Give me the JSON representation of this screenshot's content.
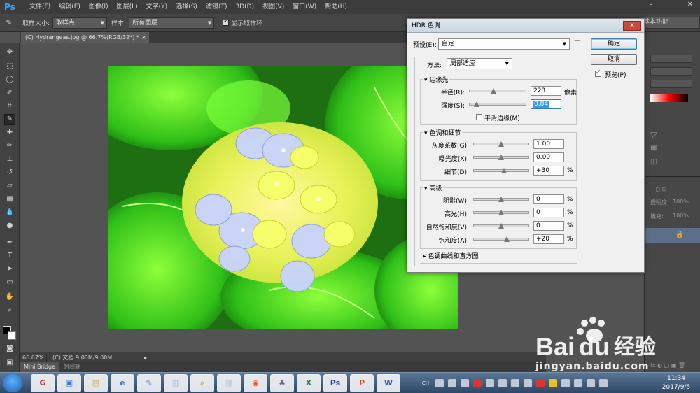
{
  "app": {
    "logo": "Ps",
    "menu": [
      "文件(F)",
      "编辑(E)",
      "图像(I)",
      "图层(L)",
      "文字(Y)",
      "选择(S)",
      "滤镜(T)",
      "3D(D)",
      "视图(V)",
      "窗口(W)",
      "帮助(H)"
    ]
  },
  "options": {
    "sample_size_label": "取样大小:",
    "sample_size_value": "取样点",
    "sample_label": "样本:",
    "sample_value": "所有图层",
    "show_ring_label": "显示取样环",
    "workspace": "基本功能"
  },
  "document": {
    "tab_title": "(C) Hydrangeas.jpg @ 66.7%(RGB/32*) *",
    "tab_close": "×",
    "zoom": "66.67%",
    "doc_info": "(C) 文档:9.00M/9.00M"
  },
  "bottom_tabs": [
    "Mini Bridge",
    "时间轴"
  ],
  "right_panel": {
    "opacity_label": "透明度:",
    "opacity_value": "100%",
    "fill_label": "填充:",
    "fill_value": "100%"
  },
  "dialog": {
    "title": "HDR 色调",
    "preset_label": "预设(E):",
    "preset_value": "自定",
    "ok": "确定",
    "cancel": "取消",
    "preview_label": "预览(P)",
    "method_label": "方法:",
    "method_value": "局部适应",
    "edge_glow": {
      "title": "边缘光",
      "radius_label": "半径(R):",
      "radius_value": "223",
      "radius_unit": "像素",
      "radius_level": 0.43,
      "strength_label": "强度(S):",
      "strength_value": "0.84",
      "strength_level": 0.12,
      "smooth_label": "平滑边缘(M)"
    },
    "tone_detail": {
      "title": "色调和细节",
      "gamma_label": "灰度系数(G):",
      "gamma_value": "1.00",
      "gamma_level": 0.5,
      "exposure_label": "曝光度(X):",
      "exposure_value": "0.00",
      "exposure_level": 0.5,
      "detail_label": "细节(D):",
      "detail_value": "+30",
      "detail_unit": "%",
      "detail_level": 0.55
    },
    "advanced": {
      "title": "高级",
      "shadow_label": "阴影(W):",
      "shadow_value": "0",
      "shadow_level": 0.5,
      "highlight_label": "高光(H):",
      "highlight_value": "0",
      "highlight_level": 0.5,
      "vibrance_label": "自然饱和度(V):",
      "vibrance_value": "0",
      "vibrance_level": 0.5,
      "saturation_label": "饱和度(A):",
      "saturation_value": "+20",
      "saturation_level": 0.6,
      "unit": "%"
    },
    "curve_title": "色调曲线和直方图"
  },
  "taskbar": {
    "apps": [
      "G",
      "▣",
      "▤",
      "e",
      "✎",
      "▥",
      "⌕",
      "▦",
      "◉",
      "♣",
      "X",
      "Ps",
      "P",
      "W"
    ],
    "tray_lang": "CH",
    "time": "11:34",
    "date": "2017/9/5"
  },
  "watermark": {
    "url": "jingyan.baidu.com"
  },
  "colors": {
    "ps_blue": "#31a8ff",
    "dialog_bg": "#f0f0f0",
    "selection": "#3399ff"
  }
}
